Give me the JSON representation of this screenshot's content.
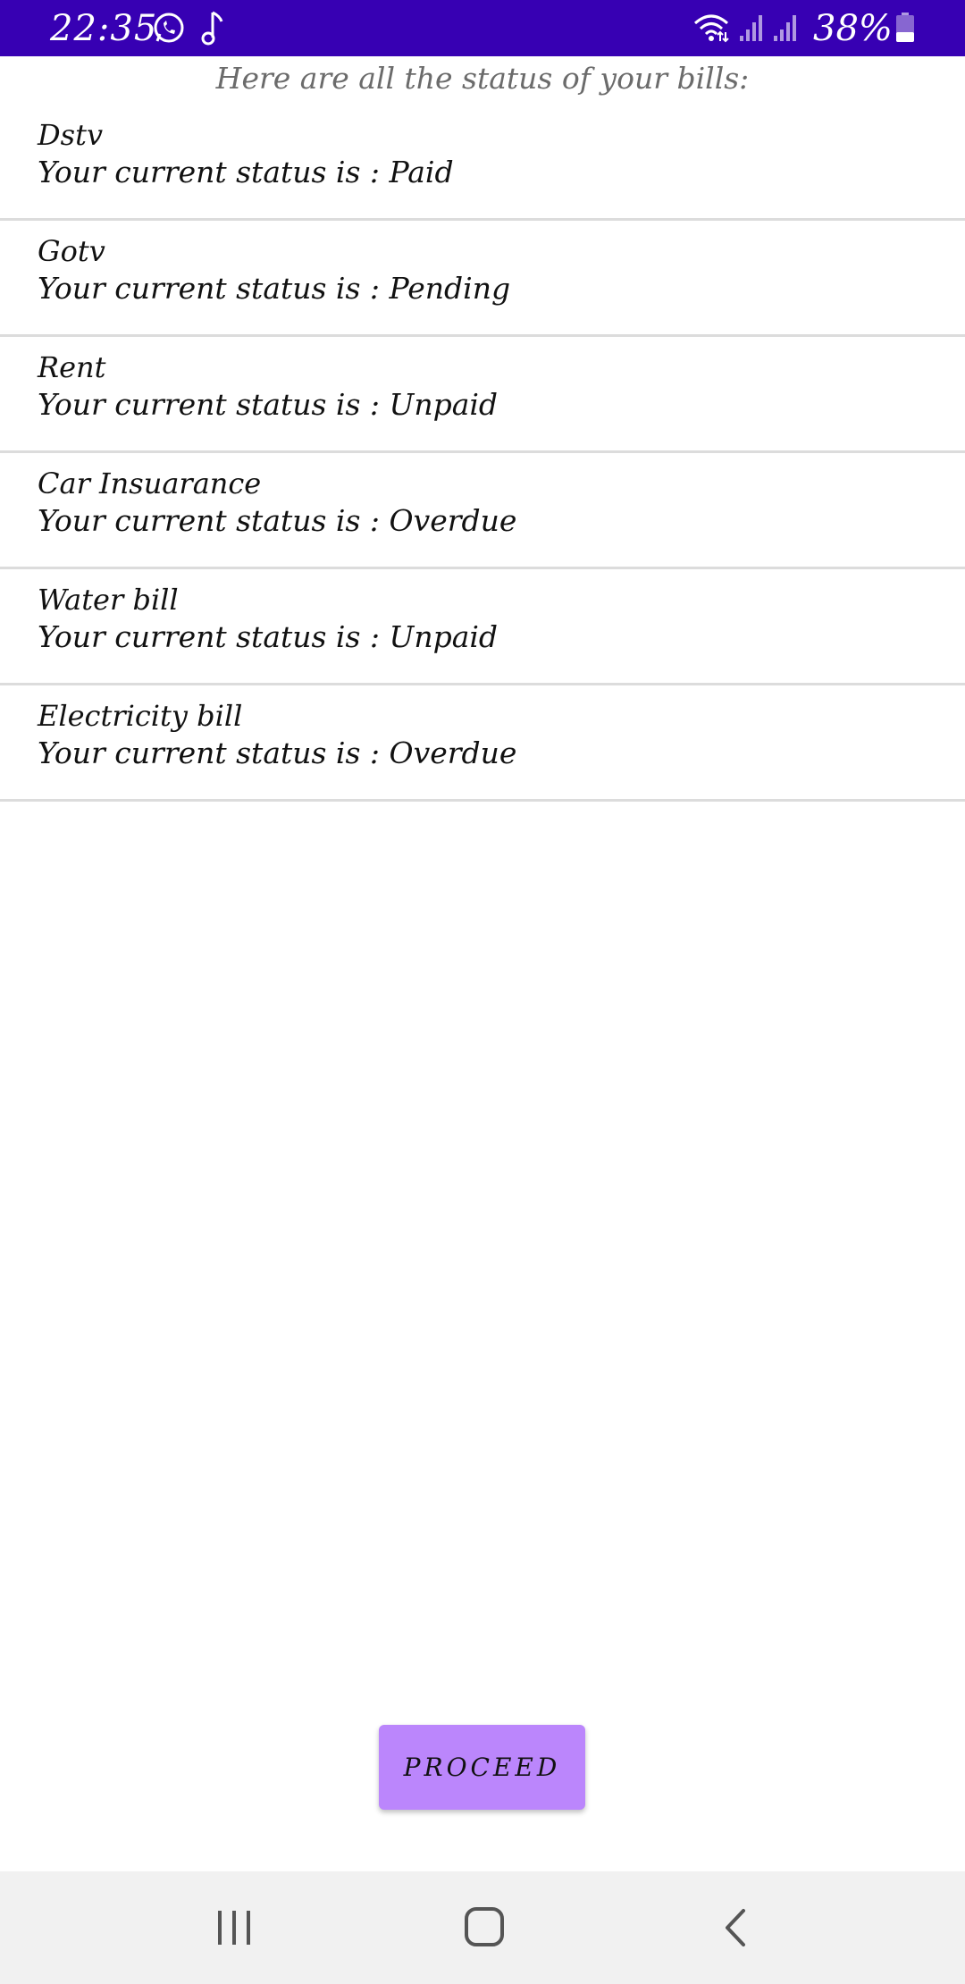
{
  "status_bar": {
    "time": "22:35",
    "battery_percent": "38%",
    "battery_level": 0.38,
    "icons": [
      "whatsapp-icon",
      "music-note-icon",
      "wifi-icon",
      "signal-icon",
      "signal-icon",
      "battery-icon"
    ]
  },
  "header": {
    "text": "Here are all the status of your bills:"
  },
  "bills": [
    {
      "name": "Dstv",
      "status": "Your current status is : Paid"
    },
    {
      "name": "Gotv",
      "status": "Your current status is : Pending"
    },
    {
      "name": "Rent",
      "status": "Your current status is : Unpaid"
    },
    {
      "name": "Car Insuarance",
      "status": "Your current status is : Overdue"
    },
    {
      "name": "Water bill",
      "status": "Your current status is : Unpaid"
    },
    {
      "name": "Electricity bill",
      "status": "Your current status is : Overdue"
    }
  ],
  "proceed_label": "Proceed",
  "colors": {
    "status_bar": "#3700b3",
    "button": "#bb86fc",
    "nav_bar": "#f1f1f1",
    "divider": "#dcdcdc"
  },
  "nav_bar": {
    "icons": [
      "recent-apps-icon",
      "home-icon",
      "back-icon"
    ]
  }
}
